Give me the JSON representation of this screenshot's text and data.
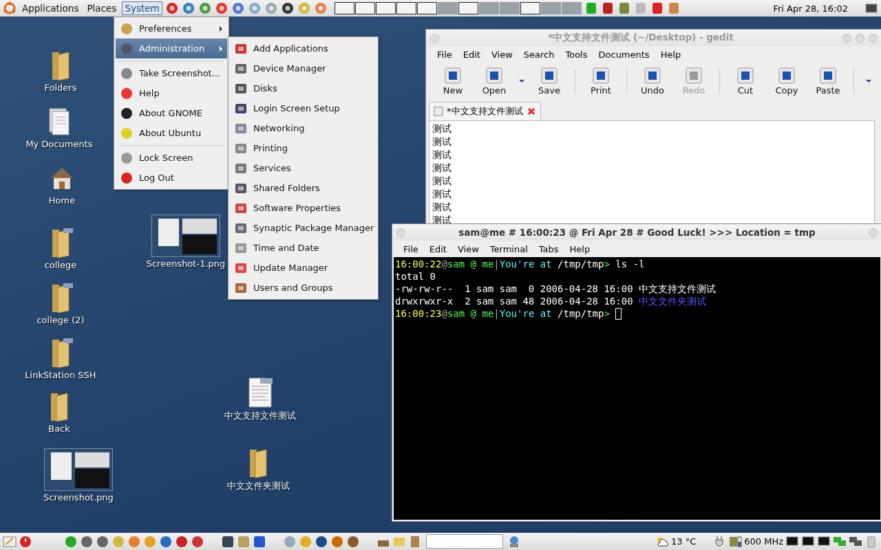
{
  "top_panel": {
    "menus": [
      {
        "label": "Applications",
        "selected": false
      },
      {
        "label": "Places",
        "selected": false
      },
      {
        "label": "System",
        "selected": true
      }
    ],
    "clock": "Fri Apr 28, 16:02"
  },
  "desktop_icons": [
    {
      "label": "Folders",
      "kind": "folder"
    },
    {
      "label": "My Documents",
      "kind": "documents"
    },
    {
      "label": "Home",
      "kind": "home"
    },
    {
      "label": "college",
      "kind": "folder_ssh"
    },
    {
      "label": "college (2)",
      "kind": "folder_smb"
    },
    {
      "label": "LinkStation SSH",
      "kind": "folder_ssh"
    },
    {
      "label": "Back",
      "kind": "folder"
    },
    {
      "label": "Screenshot.png",
      "kind": "screenshot"
    },
    {
      "label": "Screenshot-1.png",
      "kind": "screenshot"
    },
    {
      "label": "中文支持文件测试",
      "kind": "text_file"
    },
    {
      "label": "中文文件夹测试",
      "kind": "folder"
    }
  ],
  "system_menu": [
    {
      "kind": "item",
      "label": "Preferences",
      "submenu": true,
      "selected": false
    },
    {
      "kind": "item",
      "label": "Administration",
      "submenu": true,
      "selected": true
    },
    {
      "kind": "separator"
    },
    {
      "kind": "item",
      "label": "Take Screenshot...",
      "submenu": false,
      "selected": false
    },
    {
      "kind": "item",
      "label": "Help",
      "submenu": false,
      "selected": false
    },
    {
      "kind": "item",
      "label": "About GNOME",
      "submenu": false,
      "selected": false
    },
    {
      "kind": "item",
      "label": "About Ubuntu",
      "submenu": false,
      "selected": false
    },
    {
      "kind": "separator"
    },
    {
      "kind": "item",
      "label": "Lock Screen",
      "submenu": false,
      "selected": false
    },
    {
      "kind": "item",
      "label": "Log Out",
      "submenu": false,
      "selected": false
    }
  ],
  "administration_menu": [
    "Add Applications",
    "Device Manager",
    "Disks",
    "Login Screen Setup",
    "Networking",
    "Printing",
    "Services",
    "Shared Folders",
    "Software Properties",
    "Synaptic Package Manager",
    "Time and Date",
    "Update Manager",
    "Users and Groups"
  ],
  "gedit": {
    "title": "*中文支持文件测试 (~/Desktop) - gedit",
    "menu": [
      "File",
      "Edit",
      "View",
      "Search",
      "Tools",
      "Documents",
      "Help"
    ],
    "toolbar": [
      {
        "kind": "button",
        "label": "New",
        "disabled": false
      },
      {
        "kind": "button",
        "label": "Open",
        "disabled": false,
        "dropdown": true
      },
      {
        "kind": "button",
        "label": "Save",
        "disabled": false
      },
      {
        "kind": "separator"
      },
      {
        "kind": "button",
        "label": "Print",
        "disabled": false
      },
      {
        "kind": "separator"
      },
      {
        "kind": "button",
        "label": "Undo",
        "disabled": false
      },
      {
        "kind": "button",
        "label": "Redo",
        "disabled": true
      },
      {
        "kind": "separator"
      },
      {
        "kind": "button",
        "label": "Cut",
        "disabled": false
      },
      {
        "kind": "button",
        "label": "Copy",
        "disabled": false
      },
      {
        "kind": "button",
        "label": "Paste",
        "disabled": false
      },
      {
        "kind": "separator"
      }
    ],
    "tab": "*中文支持文件测试",
    "lines": [
      "测试",
      "测试",
      "测试",
      "测试",
      "测试",
      "测试",
      "测试",
      "测试"
    ]
  },
  "terminal": {
    "title": "sam@me # 16:00:23 @ Fri Apr 28 # Good Luck! >>> Location = tmp",
    "menu": [
      "File",
      "Edit",
      "View",
      "Terminal",
      "Tabs",
      "Help"
    ],
    "lines": [
      [
        {
          "text": "16:00:22",
          "color": "#ffff55"
        },
        {
          "text": "@",
          "color": "#aaaaaa"
        },
        {
          "text": "sam @ me",
          "color": "#55ff55"
        },
        {
          "text": "|",
          "color": "#aaaaaa"
        },
        {
          "text": "You're at",
          "color": "#55ffff"
        },
        {
          "text": " /tmp/tmp",
          "color": "#ffffff"
        },
        {
          "text": "> ",
          "color": "#55ff55"
        },
        {
          "text": "ls -l",
          "color": "#ffffff"
        }
      ],
      [
        {
          "text": "total 0",
          "color": "#ffffff"
        }
      ],
      [
        {
          "text": "-rw-rw-r--  1 sam sam  0 2006-04-28 16:00 ",
          "color": "#ffffff"
        },
        {
          "text": "中文支持文件测试",
          "color": "#ffffff"
        }
      ],
      [
        {
          "text": "drwxrwxr-x  2 sam sam 48 2006-04-28 16:00 ",
          "color": "#ffffff"
        },
        {
          "text": "中文文件夹测试",
          "color": "#5555ff"
        }
      ],
      [
        {
          "text": "16:00:23",
          "color": "#ffff55"
        },
        {
          "text": "@",
          "color": "#aaaaaa"
        },
        {
          "text": "sam @ me",
          "color": "#55ff55"
        },
        {
          "text": "|",
          "color": "#aaaaaa"
        },
        {
          "text": "You're at",
          "color": "#55ffff"
        },
        {
          "text": " /tmp/tmp",
          "color": "#ffffff"
        },
        {
          "text": "> ",
          "color": "#55ff55"
        }
      ]
    ],
    "cursor": true
  },
  "bottom_panel": {
    "weather": "13 °C",
    "cpu": "600 MHz"
  }
}
